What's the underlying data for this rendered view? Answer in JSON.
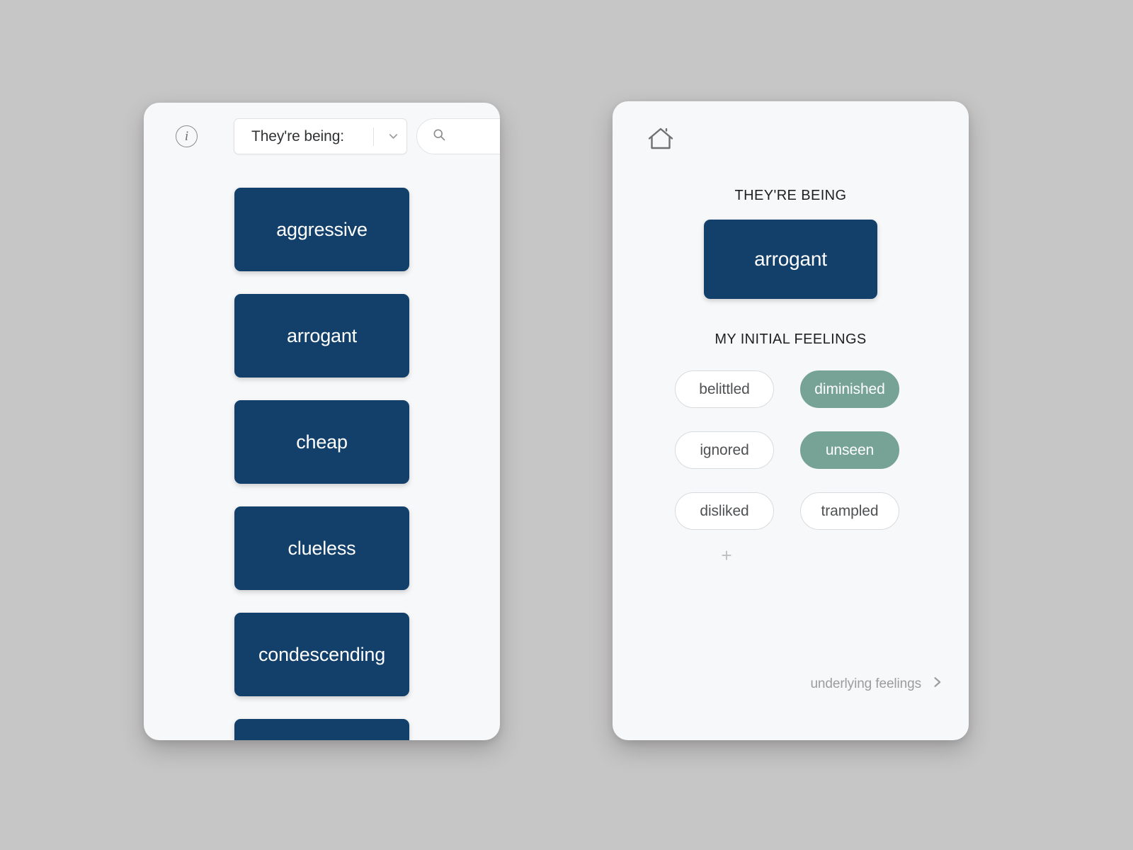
{
  "background_color": "#c7c6c6",
  "colors": {
    "card": "#f7f8f9",
    "primary_navy": "#13406a",
    "selected_green": "#76a396",
    "muted_text": "#9a9c9e"
  },
  "left_panel": {
    "info_icon_label": "i",
    "selector": {
      "label": "They're being:",
      "chevron": "chevron-down-icon"
    },
    "search": {
      "placeholder": "",
      "value": "",
      "icon": "search-icon"
    },
    "words": [
      {
        "label": "aggressive"
      },
      {
        "label": "arrogant"
      },
      {
        "label": "cheap"
      },
      {
        "label": "clueless"
      },
      {
        "label": "condescending"
      },
      {
        "label": ""
      }
    ]
  },
  "right_panel": {
    "home_icon": "home-icon",
    "theyre_being_label": "THEY'RE BEING",
    "selected_word": "arrogant",
    "initial_feelings_label": "MY INITIAL FEELINGS",
    "feelings": [
      {
        "label": "belittled",
        "selected": false
      },
      {
        "label": "diminished",
        "selected": true
      },
      {
        "label": "ignored",
        "selected": false
      },
      {
        "label": "unseen",
        "selected": true
      },
      {
        "label": "disliked",
        "selected": false
      },
      {
        "label": "trampled",
        "selected": false
      }
    ],
    "add_feeling_label": "+",
    "footer_link": {
      "label": "underlying feelings",
      "icon": "chevron-right-icon"
    }
  }
}
